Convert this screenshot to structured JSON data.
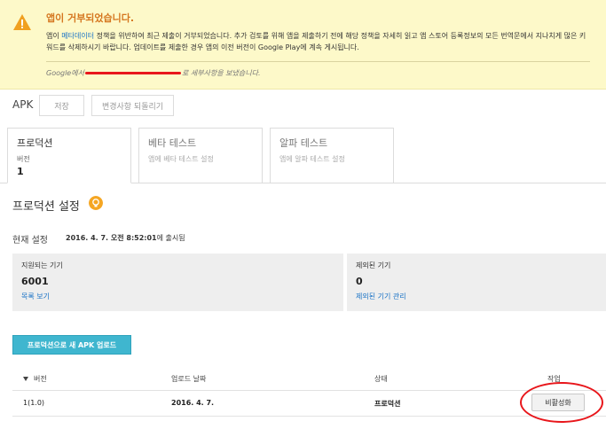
{
  "banner": {
    "title": "앱이 거부되었습니다.",
    "body_prefix": "앱이 ",
    "body_link": "메타데이터",
    "body_suffix": " 정책을 위반하여 최근 제출이 거부되었습니다. 추가 검토를 위해 앱을 제출하기 전에 해당 정책을 자세히 읽고 앱 스토어 등록정보의 모든 번역문에서 지나치게 많은 키워드를 삭제하시기 바랍니다. 업데이트를 제출한 경우 앱의 이전 버전이 Google Play에 계속 게시됩니다.",
    "note_prefix": "Google에서",
    "note_suffix": "로 세부사항을 보냈습니다."
  },
  "toolbar": {
    "apk_label": "APK",
    "save_label": "저장",
    "revert_label": "변경사항 되돌리기"
  },
  "tabs": [
    {
      "name": "프로덕션",
      "sub": "버전",
      "num": "1"
    },
    {
      "name": "베타 테스트",
      "sub": "앱에 베타 테스트 설정"
    },
    {
      "name": "알파 테스트",
      "sub": "앱에 알파 테스트 설정"
    }
  ],
  "production": {
    "title": "프로덕션 설정",
    "current_label": "현재 설정",
    "current_date": "2016. 4. 7. 오전 8:52:01",
    "current_suffix": "에 출시됨"
  },
  "devices": {
    "supported_label": "지원되는 기기",
    "supported_count": "6001",
    "supported_link": "목록 보기",
    "excluded_label": "제외된 기기",
    "excluded_count": "0",
    "excluded_link": "제외된 기기 관리"
  },
  "upload_label": "프로덕션으로 새 APK 업로드",
  "table": {
    "headers": {
      "version": "버전",
      "date": "업로드 날짜",
      "status": "상태",
      "action": "작업"
    },
    "rows": [
      {
        "version": "1(1.0)",
        "date": "2016. 4. 7.",
        "status": "프로덕션",
        "action": "비활성화"
      }
    ]
  },
  "colors": {
    "banner_bg": "#fdf9c9",
    "warning_title": "#d5761f",
    "link": "#1a73c6",
    "upload_button": "#3fb6cf",
    "annotation_red": "#e8161b"
  }
}
